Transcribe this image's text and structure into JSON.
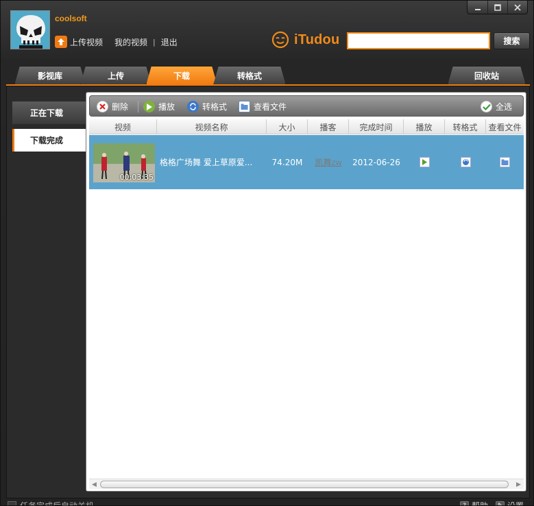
{
  "window": {
    "minimize_glyph": "—",
    "maximize_glyph": "□",
    "close_glyph": "✕"
  },
  "user": {
    "name": "coolsoft",
    "avatar_icon": "skull-avatar",
    "links": [
      "上传视频",
      "我的视频",
      "退出"
    ]
  },
  "brand": {
    "name": "iTudou",
    "icon": "tudou-face-icon"
  },
  "search": {
    "value": "",
    "button_label": "搜索"
  },
  "tabs": [
    {
      "label": "影视库",
      "active": false
    },
    {
      "label": "上传",
      "active": false
    },
    {
      "label": "下载",
      "active": true
    },
    {
      "label": "转格式",
      "active": false
    },
    {
      "label": "回收站",
      "active": false
    }
  ],
  "sidebar": {
    "items": [
      {
        "label": "正在下载",
        "active": false
      },
      {
        "label": "下载完成",
        "active": true
      }
    ]
  },
  "toolbar": {
    "delete_label": "删除",
    "play_label": "播放",
    "convert_label": "转格式",
    "view_file_label": "查看文件",
    "select_all_label": "全选"
  },
  "table": {
    "columns": [
      "视频",
      "视频名称",
      "大小",
      "播客",
      "完成时间",
      "播放",
      "转格式",
      "查看文件"
    ],
    "rows": [
      {
        "duration": "00:03:35",
        "title": "格格广场舞 爱上草原爱...",
        "size": "74.20M",
        "uploader": "凯舞",
        "uploader_tag": "ZW",
        "completed": "2012-06-26"
      }
    ]
  },
  "colors": {
    "accent": "#f07a12",
    "row_selected": "#5ba3cc",
    "username": "#f39a19"
  },
  "statusbar": {
    "auto_close_label": "任务完成后自动关机",
    "help_label": "帮助",
    "settings_label": "设置"
  }
}
